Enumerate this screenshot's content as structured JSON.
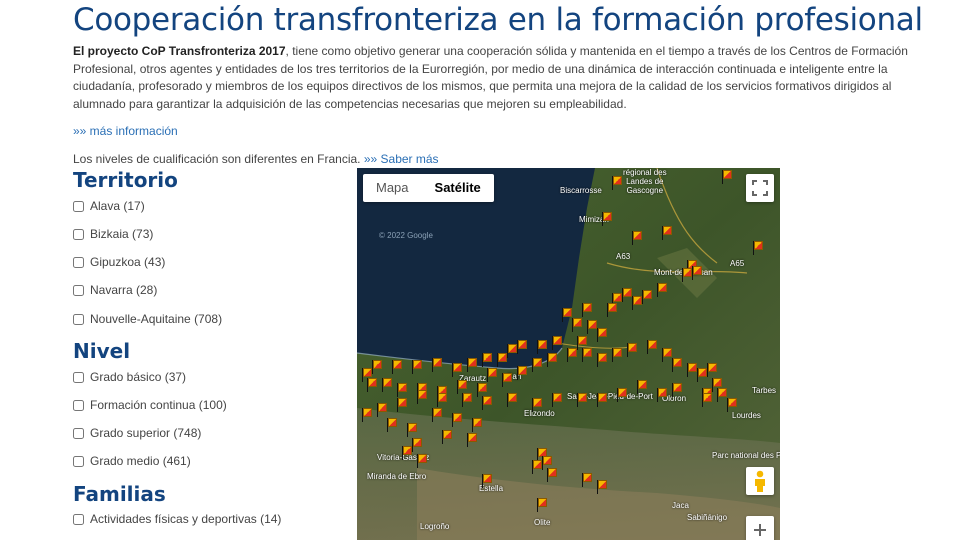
{
  "page": {
    "title": "Cooperación transfronteriza en la formación profesional",
    "intro_bold": "El proyecto CoP Transfronteriza 2017",
    "intro_rest": ", tiene como objetivo generar una cooperación sólida y mantenida en el tiempo a través de los Centros de Formación Profesional, otros agentes y entidades de los tres territorios de la Eurorregión, por medio de una dinámica de interacción continuada e inteligente entre la ciudadanía, profesorado y miembros de los equipos directivos de los mismos, que permita una mejora de la calidad de los servicios formativos dirigidos al alumnado para garantizar la adquisición de las competencias necesarias que mejoren su empleabilidad.",
    "more_link": "»» más información",
    "note_text": "Los niveles de cualificación son diferentes en Francia. ",
    "note_link": "»» Saber más"
  },
  "filters": {
    "territorio": {
      "title": "Territorio",
      "items": [
        {
          "label": "Alava (17)"
        },
        {
          "label": "Bizkaia (73)"
        },
        {
          "label": "Gipuzkoa (43)"
        },
        {
          "label": "Navarra (28)"
        },
        {
          "label": "Nouvelle-Aquitaine (708)"
        }
      ]
    },
    "nivel": {
      "title": "Nivel",
      "items": [
        {
          "label": "Grado básico (37)"
        },
        {
          "label": "Formación continua (100)"
        },
        {
          "label": "Grado superior (748)"
        },
        {
          "label": "Grado medio (461)"
        }
      ]
    },
    "familias": {
      "title": "Familias",
      "items": [
        {
          "label": "Actividades físicas y deportivas (14)"
        }
      ]
    }
  },
  "map": {
    "type_map_label": "Mapa",
    "type_satellite_label": "Satélite",
    "selected_type": "Satélite",
    "watermark": "© 2022 Google",
    "fullscreen_icon": "fullscreen-icon",
    "pegman_icon": "pegman-icon",
    "zoom_in_icon": "plus-icon",
    "places": {
      "biscarrosse": "Biscarrosse",
      "landes": "régional des\nLandes de\nGascogne",
      "mimizan": "Mimizan",
      "a63": "A63",
      "a65": "A65",
      "montmarsan": "Mont-de-Marsan",
      "san": "San",
      "elizondo": "Elizondo",
      "sanjean": "Saint-Jean-Pied-de-Port",
      "oloron": "Oloron",
      "tarbes": "Tarbes",
      "lourdes": "Lourdes",
      "vitoria": "Vitoria-Gasteiz",
      "miranda": "Miranda de Ebro",
      "estella": "Estella",
      "pyrenees": "Parc national des Pyrénées",
      "sabinanigo": "Sabiñánigo",
      "jaca": "Jaca",
      "logrono": "Logroño",
      "olite": "Olite",
      "zarautz": "Zarautz"
    }
  },
  "colors": {
    "title": "#13447f",
    "link": "#2a6fb5",
    "sea": "#132840",
    "land": "#3f5a2b",
    "marker_yellow": "#f5b800",
    "marker_red": "#e0311c"
  }
}
